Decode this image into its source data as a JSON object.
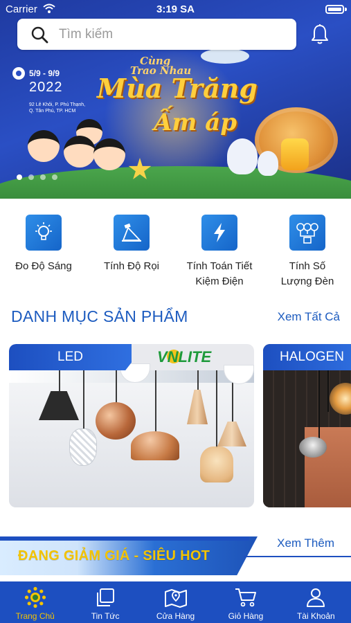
{
  "status_bar": {
    "carrier": "Carrier",
    "time": "3:19 SA"
  },
  "search": {
    "placeholder": "Tìm kiếm"
  },
  "banner": {
    "small_line_1": "Cùng",
    "small_line_2": "Trao Nhau",
    "headline_1": "Mùa Trăng",
    "headline_2": "Ấm áp",
    "date_range": "5/9 - 9/9",
    "year": "2022",
    "address": "92 Lê Khôi, P. Phú Thạnh, Q. Tân Phú, TP. HCM",
    "slide_count": 4,
    "active_slide": 1
  },
  "tools": [
    {
      "icon": "bulb-icon",
      "label_1": "Đo Độ Sáng",
      "label_2": ""
    },
    {
      "icon": "spotlight-icon",
      "label_1": "Tính Độ Rọi",
      "label_2": ""
    },
    {
      "icon": "lightning-icon",
      "label_1": "Tính Toán Tiết",
      "label_2": "Kiệm Điện"
    },
    {
      "icon": "bulbs-count-icon",
      "label_1": "Tính Số",
      "label_2": "Lượng Đèn"
    }
  ],
  "categories_section": {
    "title": "DANH MỤC SẢN PHẨM",
    "see_all": "Xem Tất Cả",
    "items": [
      {
        "label": "LED",
        "brand": "VNLITE"
      },
      {
        "label": "HALOGEN"
      }
    ]
  },
  "promo": {
    "title": "ĐANG GIẢM GIÁ - SIÊU HOT",
    "see_more": "Xem Thêm"
  },
  "tabbar": {
    "tabs": [
      {
        "label": "Trang Chủ",
        "icon": "sun-home-icon",
        "active": true
      },
      {
        "label": "Tin Tức",
        "icon": "news-icon",
        "active": false
      },
      {
        "label": "Cửa Hàng",
        "icon": "map-icon",
        "active": false
      },
      {
        "label": "Giỏ Hàng",
        "icon": "cart-icon",
        "active": false
      },
      {
        "label": "Tài Khoản",
        "icon": "user-icon",
        "active": false
      }
    ]
  },
  "colors": {
    "primary": "#1d4fc0",
    "accent_yellow": "#f5c400",
    "link_blue": "#1c5bbf"
  }
}
